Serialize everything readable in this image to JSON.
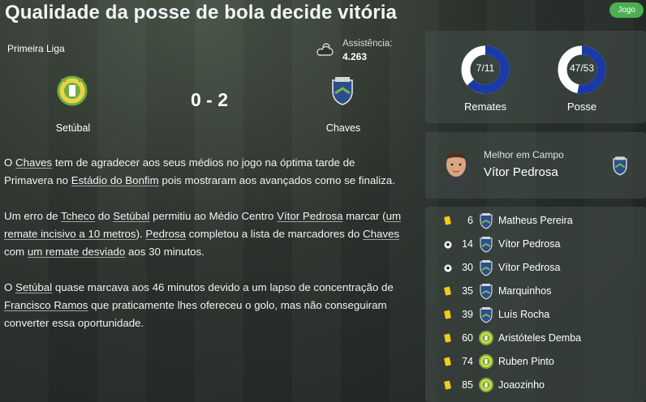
{
  "header": {
    "title": "Qualidade da posse de bola decide vitória",
    "badge": "Jogo"
  },
  "match": {
    "competition": "Primeira Liga",
    "attendance_label": "Assistência:",
    "attendance": "4.263",
    "score": "0 - 2",
    "home_team": "Setúbal",
    "away_team": "Chaves",
    "weather_icon": "cloud-icon"
  },
  "report": {
    "p1": [
      "O ",
      "Chaves",
      " tem de agradecer aos seus médios no jogo na óptima tarde de Primavera no ",
      "Estádio do Bonfim",
      " pois mostraram aos avançados como se finaliza."
    ],
    "p2": [
      "Um erro de ",
      "Tcheco",
      " do ",
      "Setúbal",
      " permitiu ao Médio Centro ",
      "Vítor Pedrosa",
      " marcar (",
      "um remate incisivo a 10 metros",
      "). ",
      "Pedrosa",
      " completou a lista de marcadores do ",
      "Chaves",
      " com ",
      "um remate desviado",
      " aos 30 minutos."
    ],
    "p3": [
      "O ",
      "Setúbal",
      " quase marcava aos 46 minutos devido a um lapso de concentração de ",
      "Francisco Ramos",
      " que praticamente lhes ofereceu o golo, mas não conseguiram converter essa oportunidade."
    ]
  },
  "stats": {
    "shots": {
      "value_text": "7/11",
      "label": "Remates",
      "fraction": 0.636
    },
    "possession": {
      "value_text": "47/53",
      "label": "Posse",
      "fraction": 0.53
    },
    "ring_color": "#1a3aa8",
    "ring_bg": "#ffffff"
  },
  "mvp": {
    "label": "Melhor em Campo",
    "name": "Vítor Pedrosa"
  },
  "events": [
    {
      "type": "yellow-card",
      "minute": "6",
      "team": "away",
      "name": "Matheus Pereira"
    },
    {
      "type": "goal",
      "minute": "14",
      "team": "away",
      "name": "Vítor Pedrosa"
    },
    {
      "type": "goal",
      "minute": "30",
      "team": "away",
      "name": "Vítor Pedrosa"
    },
    {
      "type": "yellow-card",
      "minute": "35",
      "team": "away",
      "name": "Marquinhos"
    },
    {
      "type": "yellow-card",
      "minute": "39",
      "team": "away",
      "name": "Luís Rocha"
    },
    {
      "type": "yellow-card",
      "minute": "60",
      "team": "home",
      "name": "Aristóteles Demba"
    },
    {
      "type": "yellow-card",
      "minute": "74",
      "team": "home",
      "name": "Ruben Pinto"
    },
    {
      "type": "yellow-card",
      "minute": "85",
      "team": "home",
      "name": "Joaozinho"
    }
  ],
  "colors": {
    "home_green": "#6fae3c",
    "home_yellow": "#e8d34a",
    "away_blue": "#2c4f8c",
    "card_yellow": "#f2cc1a",
    "badge_green": "#4caf50"
  }
}
